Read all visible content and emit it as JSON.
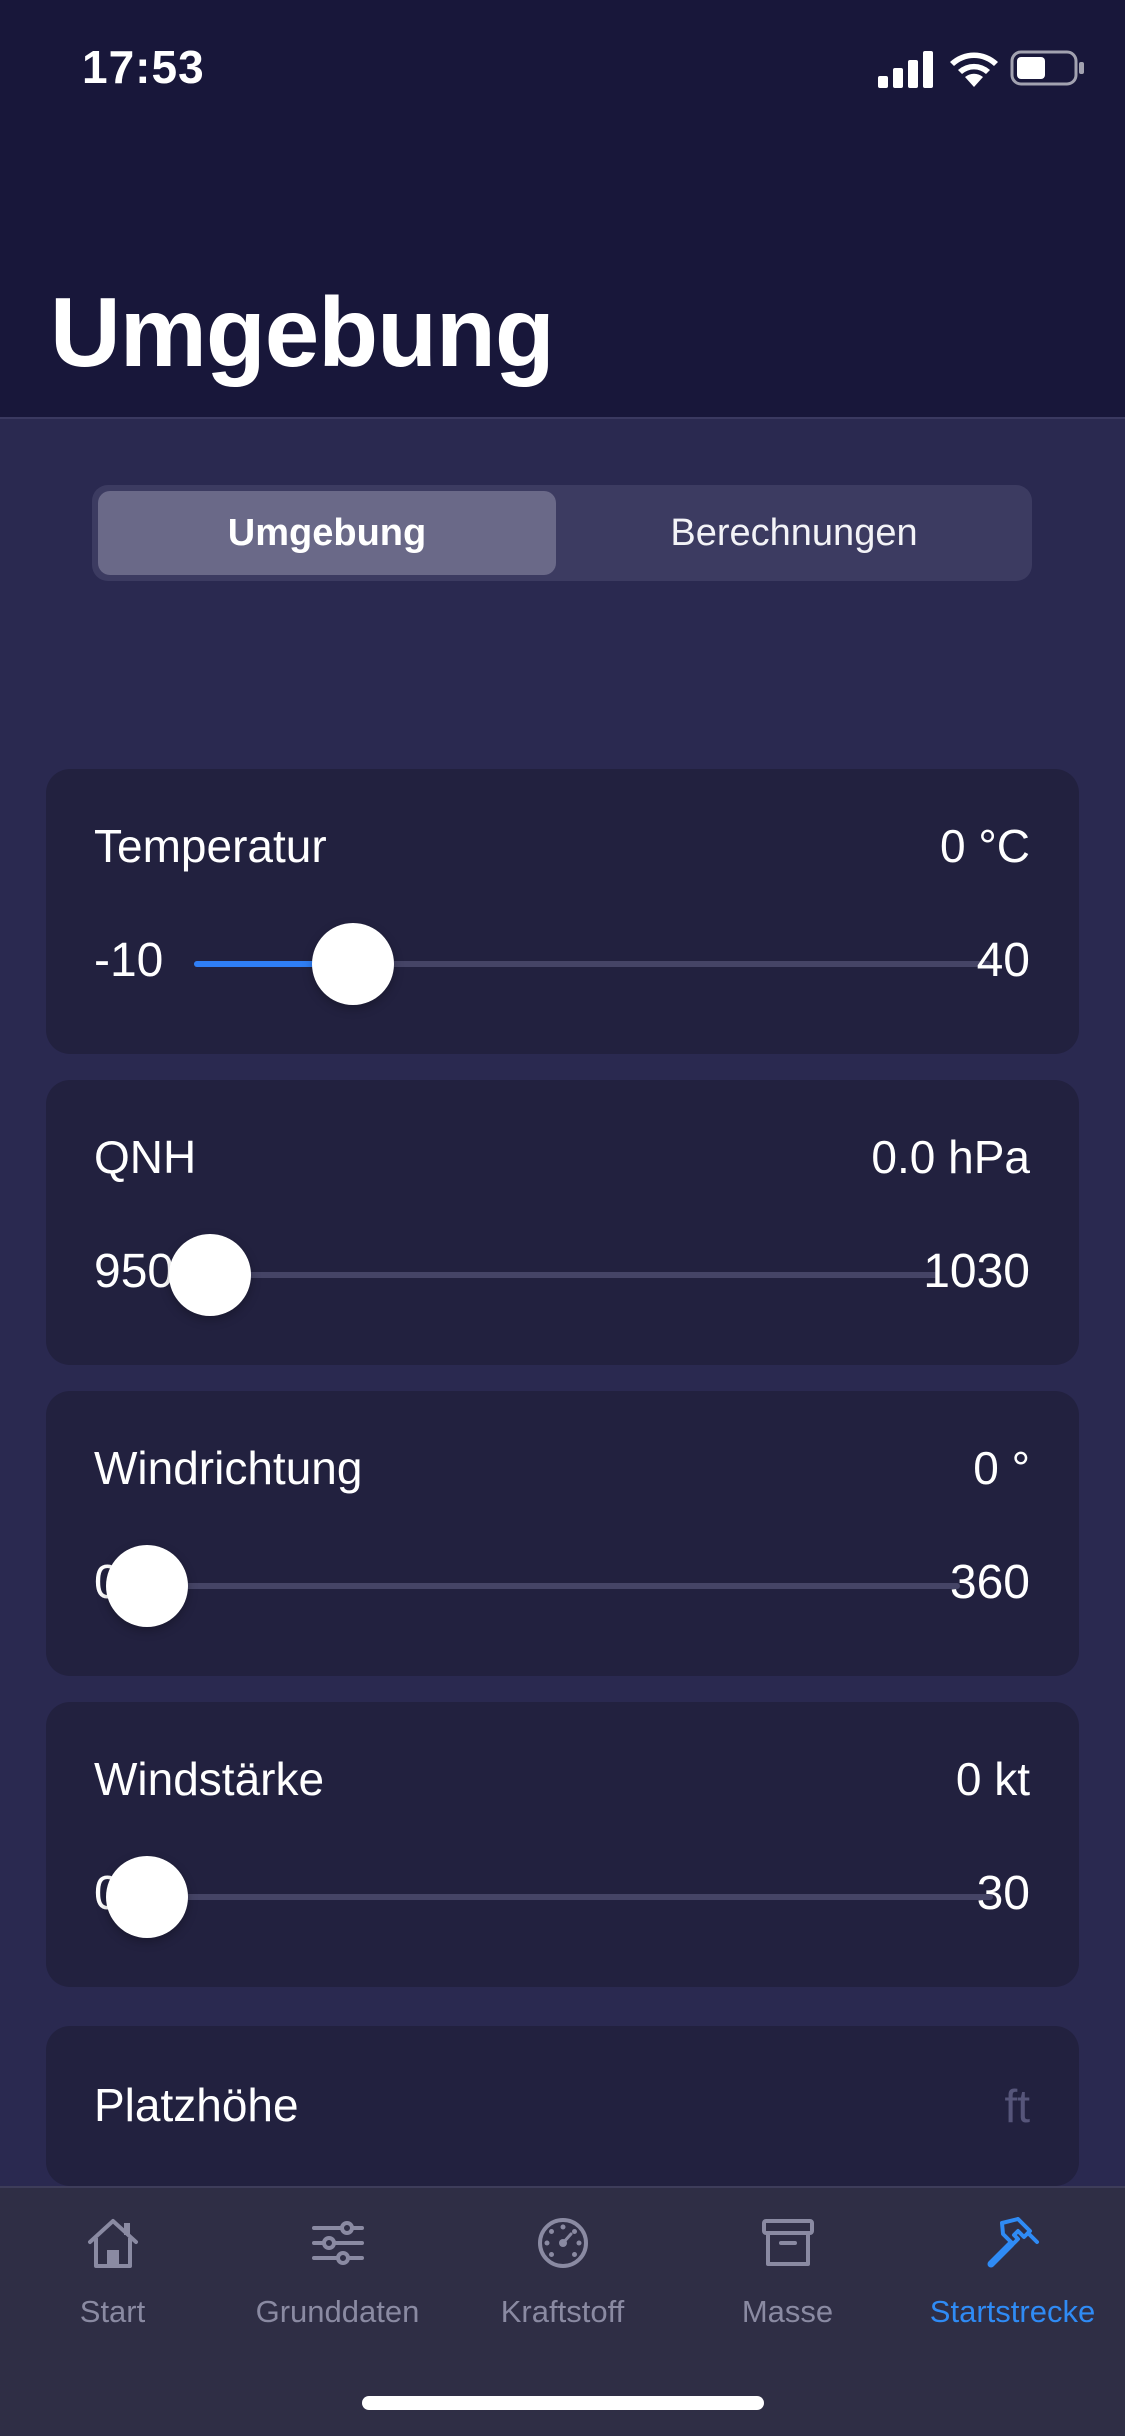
{
  "status_bar": {
    "time": "17:53"
  },
  "header": {
    "title": "Umgebung"
  },
  "segmented_control": {
    "options": [
      "Umgebung",
      "Berechnungen"
    ],
    "selected": "Umgebung"
  },
  "cards": [
    {
      "title": "Temperatur",
      "value": "0 °C",
      "min_label": "-10",
      "max_label": "40",
      "slider_value": 0,
      "slider_min": -10,
      "slider_max": 40
    },
    {
      "title": "QNH",
      "value": "0.0 hPa",
      "min_label": "950",
      "max_label": "1030",
      "slider_value": 950,
      "slider_min": 950,
      "slider_max": 1030
    },
    {
      "title": "Windrichtung",
      "value": "0 °",
      "min_label": "0",
      "max_label": "360",
      "slider_value": 0,
      "slider_min": 0,
      "slider_max": 360
    },
    {
      "title": "Windstärke",
      "value": "0 kt",
      "min_label": "0",
      "max_label": "30",
      "slider_value": 0,
      "slider_min": 0,
      "slider_max": 30
    }
  ],
  "platzhoehe": {
    "label": "Platzhöhe",
    "placeholder": "ft",
    "value": ""
  },
  "tab_bar": {
    "items": [
      {
        "label": "Start",
        "icon": "house-icon"
      },
      {
        "label": "Grunddaten",
        "icon": "sliders-icon"
      },
      {
        "label": "Kraftstoff",
        "icon": "gauge-icon"
      },
      {
        "label": "Masse",
        "icon": "archive-box-icon"
      },
      {
        "label": "Startstrecke",
        "icon": "hammer-icon"
      }
    ],
    "active": "Startstrecke"
  },
  "colors": {
    "accent": "#2f7ef5",
    "header_bg": "#18173a",
    "page_bg": "#2a2950",
    "card_bg": "#22213f"
  }
}
